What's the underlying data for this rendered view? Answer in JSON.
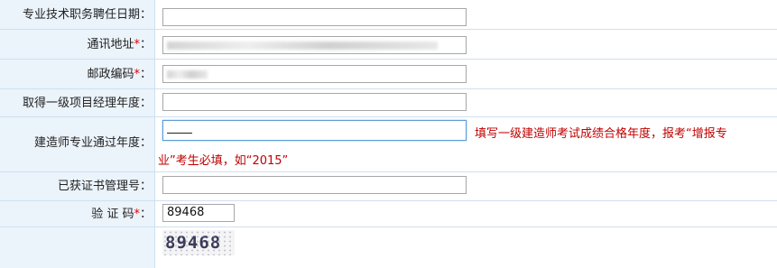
{
  "fields": {
    "appoint_date": {
      "label": "专业技术职务聘任日期：",
      "value": ""
    },
    "address": {
      "label": "通讯地址",
      "required_mark": "*",
      "colon": "：",
      "value": ""
    },
    "postcode": {
      "label": "邮政编码",
      "required_mark": "*",
      "colon": "：",
      "value": ""
    },
    "pm_year": {
      "label": "取得一级项目经理年度：",
      "value": ""
    },
    "builder_year": {
      "label": "建造师专业通过年度：",
      "value": "",
      "hint_line1": "填写一级建造师考试成绩合格年度，报考“增报专",
      "hint_line2": "业”考生必填，如“2015”"
    },
    "cert_no": {
      "label": "已获证书管理号：",
      "value": ""
    },
    "captcha": {
      "label": "验 证 码",
      "required_mark": "*",
      "colon": "：",
      "value": "89468",
      "image_text": "89468"
    }
  }
}
